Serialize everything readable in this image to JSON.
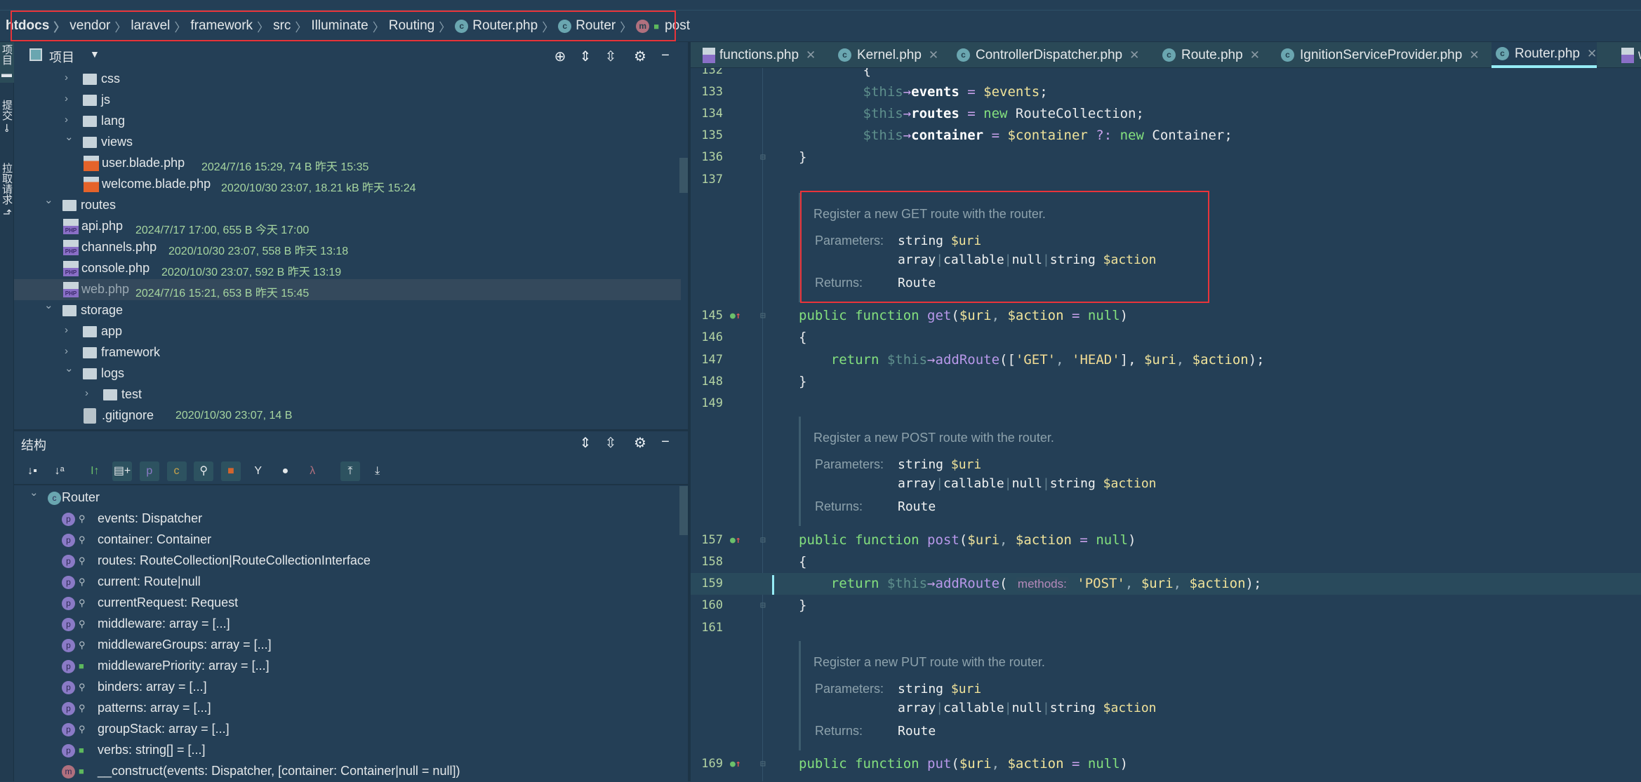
{
  "breadcrumb": [
    {
      "label": "htdocs",
      "icon": null
    },
    {
      "label": "vendor",
      "icon": null
    },
    {
      "label": "laravel",
      "icon": null
    },
    {
      "label": "framework",
      "icon": null
    },
    {
      "label": "src",
      "icon": null
    },
    {
      "label": "Illuminate",
      "icon": null
    },
    {
      "label": "Routing",
      "icon": null
    },
    {
      "label": "Router.php",
      "icon": "class-icon"
    },
    {
      "label": "Router",
      "icon": "class-icon"
    },
    {
      "label": "post",
      "icon": "method-icon"
    }
  ],
  "left_strip": {
    "items": [
      {
        "label": "项目"
      },
      {
        "label": "提交"
      },
      {
        "label": "拉取请求"
      }
    ]
  },
  "project_panel": {
    "title": "项目",
    "tree": [
      {
        "name": "css",
        "depth": 1,
        "type": "folder",
        "expanded": false
      },
      {
        "name": "js",
        "depth": 1,
        "type": "folder",
        "expanded": false
      },
      {
        "name": "lang",
        "depth": 1,
        "type": "folder",
        "expanded": false
      },
      {
        "name": "views",
        "depth": 1,
        "type": "folder",
        "expanded": true
      },
      {
        "name": "user.blade.php",
        "depth": 2,
        "type": "blade",
        "meta": "2024/7/16 15:29, 74 B 昨天 15:35"
      },
      {
        "name": "welcome.blade.php",
        "depth": 2,
        "type": "blade",
        "meta": "2020/10/30 23:07, 18.21 kB 昨天 15:24"
      },
      {
        "name": "routes",
        "depth": 0,
        "type": "folder",
        "expanded": true
      },
      {
        "name": "api.php",
        "depth": 1,
        "type": "php",
        "meta": "2024/7/17 17:00, 655 B 今天 17:00"
      },
      {
        "name": "channels.php",
        "depth": 1,
        "type": "php",
        "meta": "2020/10/30 23:07, 558 B 昨天 13:18"
      },
      {
        "name": "console.php",
        "depth": 1,
        "type": "php",
        "meta": "2020/10/30 23:07, 592 B 昨天 13:19"
      },
      {
        "name": "web.php",
        "depth": 1,
        "type": "php",
        "meta": "2024/7/16 15:21, 653 B 昨天 15:45",
        "selected": true
      },
      {
        "name": "storage",
        "depth": 0,
        "type": "folder",
        "expanded": true
      },
      {
        "name": "app",
        "depth": 1,
        "type": "folder",
        "expanded": false
      },
      {
        "name": "framework",
        "depth": 1,
        "type": "folder",
        "expanded": false
      },
      {
        "name": "logs",
        "depth": 1,
        "type": "folder",
        "expanded": true
      },
      {
        "name": "test",
        "depth": 2,
        "type": "folder",
        "expanded": false
      },
      {
        "name": ".gitignore",
        "depth": 2,
        "type": "gitignore",
        "meta": "2020/10/30 23:07, 14 B"
      }
    ]
  },
  "structure_panel": {
    "title": "结构",
    "toolbar": [
      "sort-by-visibility-icon",
      "sort-alpha-icon",
      "show-inherited-icon",
      "show-includes-icon",
      "show-properties-icon",
      "show-constants-icon",
      "show-fields-icon",
      "show-private-icon",
      "show-traits-icon",
      "show-circles-icon",
      "show-lambda-icon",
      "scroll-from-source-icon",
      "scroll-to-source-icon"
    ],
    "root": "Router",
    "items": [
      {
        "label": "events: Dispatcher",
        "kind": "p",
        "visibility": "protected"
      },
      {
        "label": "container: Container",
        "kind": "p",
        "visibility": "protected"
      },
      {
        "label": "routes: RouteCollection|RouteCollectionInterface",
        "kind": "p",
        "visibility": "protected"
      },
      {
        "label": "current: Route|null",
        "kind": "p",
        "visibility": "protected"
      },
      {
        "label": "currentRequest: Request",
        "kind": "p",
        "visibility": "protected"
      },
      {
        "label": "middleware: array = [...]",
        "kind": "p",
        "visibility": "protected"
      },
      {
        "label": "middlewareGroups: array = [...]",
        "kind": "p",
        "visibility": "protected"
      },
      {
        "label": "middlewarePriority: array = [...]",
        "kind": "p",
        "visibility": "public"
      },
      {
        "label": "binders: array = [...]",
        "kind": "p",
        "visibility": "protected"
      },
      {
        "label": "patterns: array = [...]",
        "kind": "p",
        "visibility": "protected"
      },
      {
        "label": "groupStack: array = [...]",
        "kind": "p",
        "visibility": "protected"
      },
      {
        "label": "verbs: string[] = [...]",
        "kind": "p",
        "visibility": "public"
      },
      {
        "label": "__construct(events: Dispatcher, [container: Container|null = null])",
        "kind": "m",
        "visibility": "public"
      }
    ]
  },
  "tabs": [
    {
      "label": "functions.php",
      "icon": "php-file-icon"
    },
    {
      "label": "Kernel.php",
      "icon": "class-icon"
    },
    {
      "label": "ControllerDispatcher.php",
      "icon": "class-icon"
    },
    {
      "label": "Route.php",
      "icon": "class-icon"
    },
    {
      "label": "IgnitionServiceProvider.php",
      "icon": "class-icon"
    },
    {
      "label": "Router.php",
      "icon": "class-icon",
      "active": true
    },
    {
      "label": "w",
      "icon": "php-file-icon"
    }
  ],
  "code": [
    {
      "type": "line",
      "num": "132",
      "tokens": [
        [
          "        ",
          "plain"
        ],
        [
          "{",
          "plain"
        ]
      ]
    },
    {
      "type": "line",
      "num": "133",
      "tokens": [
        [
          "        ",
          "plain"
        ],
        [
          "$this",
          "this"
        ],
        [
          "→",
          "op"
        ],
        [
          "events",
          "prop"
        ],
        [
          " = ",
          "op"
        ],
        [
          "$events",
          "var"
        ],
        [
          ";",
          "plain"
        ]
      ]
    },
    {
      "type": "line",
      "num": "134",
      "tokens": [
        [
          "        ",
          "plain"
        ],
        [
          "$this",
          "this"
        ],
        [
          "→",
          "op"
        ],
        [
          "routes",
          "prop"
        ],
        [
          " = ",
          "op"
        ],
        [
          "new ",
          "kw"
        ],
        [
          "RouteCollection",
          "plain"
        ],
        [
          ";",
          "plain"
        ]
      ]
    },
    {
      "type": "line",
      "num": "135",
      "tokens": [
        [
          "        ",
          "plain"
        ],
        [
          "$this",
          "this"
        ],
        [
          "→",
          "op"
        ],
        [
          "container",
          "prop"
        ],
        [
          " = ",
          "op"
        ],
        [
          "$container",
          "var"
        ],
        [
          " ?: ",
          "op"
        ],
        [
          "new ",
          "kw"
        ],
        [
          "Container",
          "plain"
        ],
        [
          ";",
          "plain"
        ]
      ]
    },
    {
      "type": "line",
      "num": "136",
      "fold": true,
      "tokens": [
        [
          "",
          "plain"
        ],
        [
          "}",
          "plain"
        ]
      ]
    },
    {
      "type": "line",
      "num": "137",
      "tokens": []
    },
    {
      "type": "doc",
      "desc": "Register a new GET route with the router.",
      "params_label": "Parameters:",
      "params": [
        [
          "string ",
          "$uri"
        ],
        [
          "array|callable|null|string ",
          "$action"
        ]
      ],
      "returns_label": "Returns:",
      "returns": "Route",
      "highlighted": true
    },
    {
      "type": "line",
      "num": "145",
      "impl": true,
      "fold": true,
      "tokens": [
        [
          "public function ",
          "kw"
        ],
        [
          "get",
          "fn"
        ],
        [
          "(",
          "plain"
        ],
        [
          "$uri",
          "var"
        ],
        [
          ", ",
          "punc"
        ],
        [
          "$action",
          "var"
        ],
        [
          " = ",
          "op"
        ],
        [
          "null",
          "kw"
        ],
        [
          ")",
          "plain"
        ]
      ]
    },
    {
      "type": "line",
      "num": "146",
      "tokens": [
        [
          "{",
          "plain"
        ]
      ]
    },
    {
      "type": "line",
      "num": "147",
      "tokens": [
        [
          "    ",
          "plain"
        ],
        [
          "return ",
          "kw"
        ],
        [
          "$this",
          "this"
        ],
        [
          "→",
          "op"
        ],
        [
          "addRoute",
          "fn"
        ],
        [
          "([",
          "plain"
        ],
        [
          "'GET'",
          "str"
        ],
        [
          ", ",
          "punc"
        ],
        [
          "'HEAD'",
          "str"
        ],
        [
          "], ",
          "plain"
        ],
        [
          "$uri",
          "var"
        ],
        [
          ", ",
          "punc"
        ],
        [
          "$action",
          "var"
        ],
        [
          ");",
          "plain"
        ]
      ]
    },
    {
      "type": "line",
      "num": "148",
      "tokens": [
        [
          "}",
          "plain"
        ]
      ]
    },
    {
      "type": "line",
      "num": "149",
      "tokens": []
    },
    {
      "type": "doc",
      "desc": "Register a new POST route with the router.",
      "params_label": "Parameters:",
      "params": [
        [
          "string ",
          "$uri"
        ],
        [
          "array|callable|null|string ",
          "$action"
        ]
      ],
      "returns_label": "Returns:",
      "returns": "Route"
    },
    {
      "type": "line",
      "num": "157",
      "impl": true,
      "fold": true,
      "tokens": [
        [
          "public function ",
          "kw"
        ],
        [
          "post",
          "fn"
        ],
        [
          "(",
          "plain"
        ],
        [
          "$uri",
          "var"
        ],
        [
          ", ",
          "punc"
        ],
        [
          "$action",
          "var"
        ],
        [
          " = ",
          "op"
        ],
        [
          "null",
          "kw"
        ],
        [
          ")",
          "plain"
        ]
      ]
    },
    {
      "type": "line",
      "num": "158",
      "tokens": [
        [
          "{",
          "plain"
        ]
      ]
    },
    {
      "type": "line",
      "num": "159",
      "current": true,
      "tokens": [
        [
          "    ",
          "plain"
        ],
        [
          "return ",
          "kw"
        ],
        [
          "$this",
          "this"
        ],
        [
          "→",
          "op"
        ],
        [
          "addRoute",
          "fn"
        ],
        [
          "( ",
          "plain"
        ],
        [
          "methods:",
          "hint"
        ],
        [
          " 'POST'",
          "str"
        ],
        [
          ", ",
          "punc"
        ],
        [
          "$uri",
          "var"
        ],
        [
          ", ",
          "punc"
        ],
        [
          "$action",
          "var"
        ],
        [
          ");",
          "plain"
        ]
      ]
    },
    {
      "type": "line",
      "num": "160",
      "fold": true,
      "tokens": [
        [
          "}",
          "plain"
        ]
      ]
    },
    {
      "type": "line",
      "num": "161",
      "tokens": []
    },
    {
      "type": "doc",
      "desc": "Register a new PUT route with the router.",
      "params_label": "Parameters:",
      "params": [
        [
          "string ",
          "$uri"
        ],
        [
          "array|callable|null|string ",
          "$action"
        ]
      ],
      "returns_label": "Returns:",
      "returns": "Route"
    },
    {
      "type": "line",
      "num": "169",
      "impl": true,
      "fold": true,
      "tokens": [
        [
          "public function ",
          "kw"
        ],
        [
          "put",
          "fn"
        ],
        [
          "(",
          "plain"
        ],
        [
          "$uri",
          "var"
        ],
        [
          ", ",
          "punc"
        ],
        [
          "$action",
          "var"
        ],
        [
          " = ",
          "op"
        ],
        [
          "null",
          "kw"
        ],
        [
          ")",
          "plain"
        ]
      ]
    }
  ],
  "colors": {
    "background": "#243f56",
    "active_tab_underline": "#96ecf6",
    "highlight_box": "#e8343a"
  }
}
